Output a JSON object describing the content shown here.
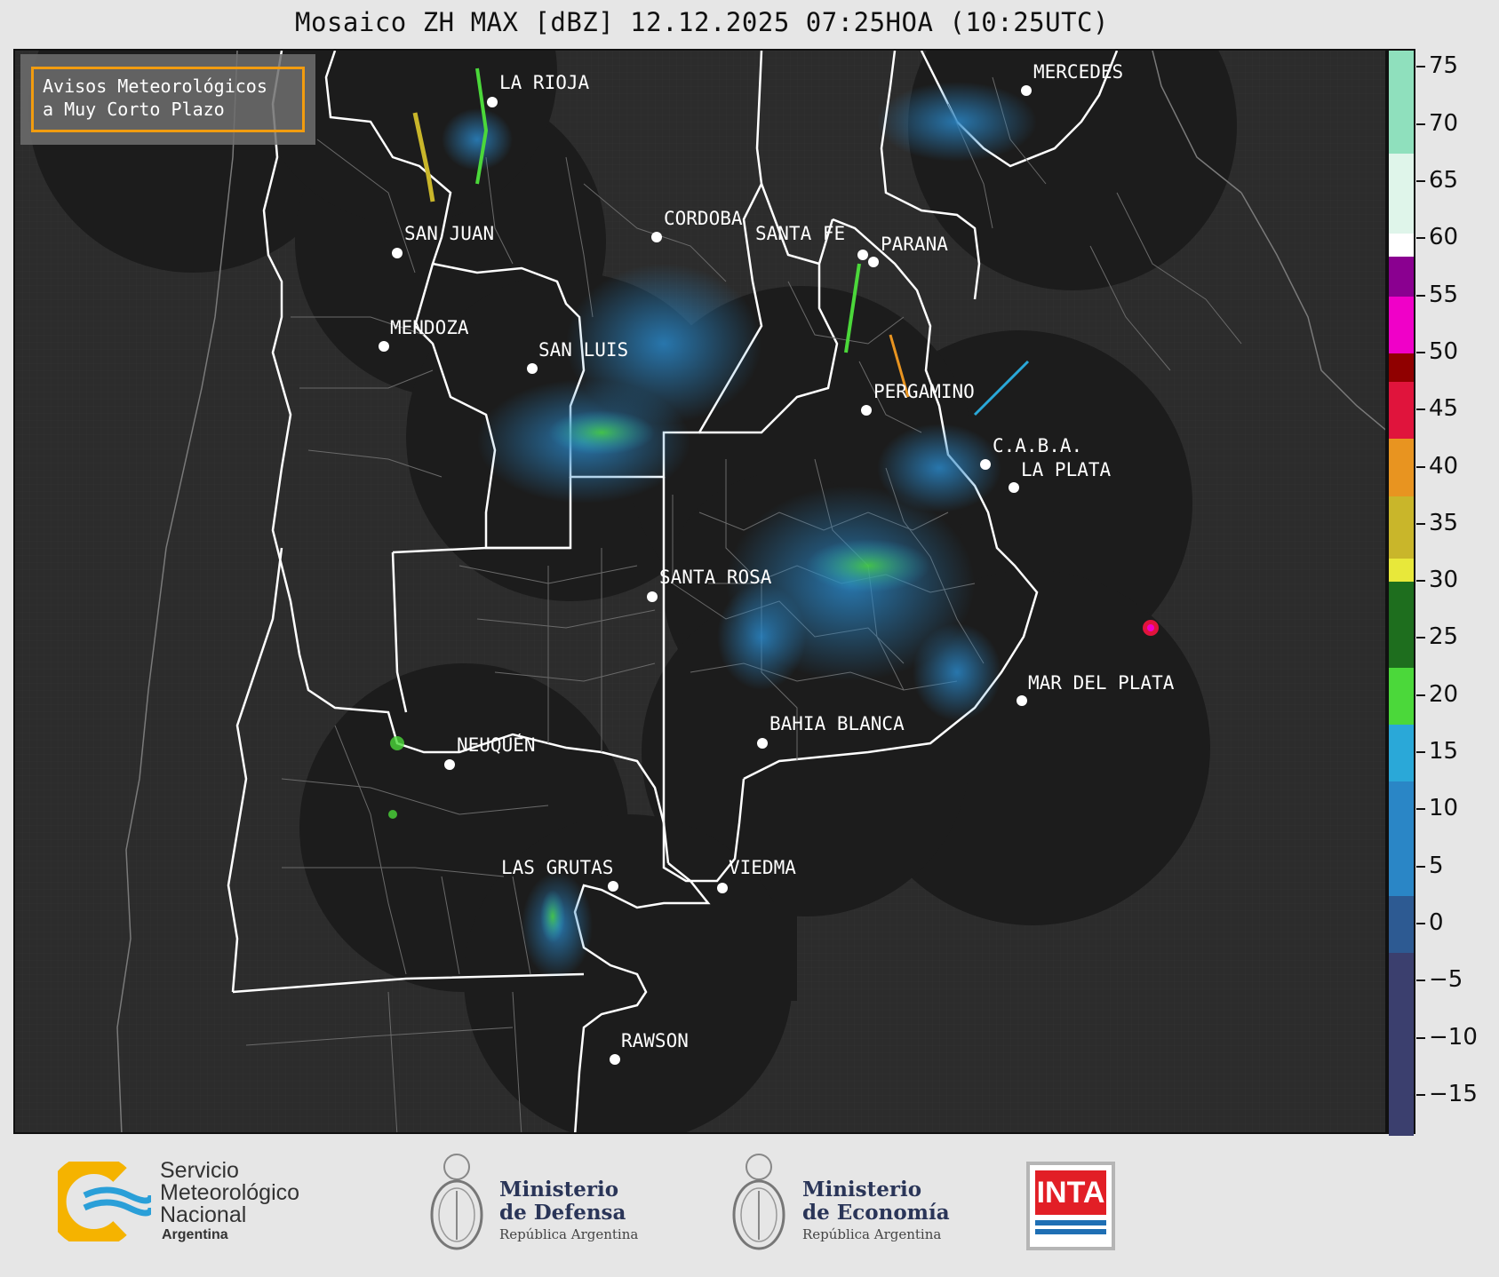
{
  "title": "Mosaico ZH MAX [dBZ] 12.12.2025 07:25HOA (10:25UTC)",
  "notice": {
    "line1": "Avisos Meteorológicos",
    "line2": "a Muy Corto Plazo"
  },
  "cities": [
    {
      "id": "la-rioja",
      "name": "LA RIOJA"
    },
    {
      "id": "mercedes",
      "name": "MERCEDES"
    },
    {
      "id": "cordoba",
      "name": "CORDOBA"
    },
    {
      "id": "san-juan",
      "name": "SAN JUAN"
    },
    {
      "id": "santa-fe",
      "name": "SANTA FE"
    },
    {
      "id": "parana",
      "name": "PARANA"
    },
    {
      "id": "mendoza",
      "name": "MENDOZA"
    },
    {
      "id": "san-luis",
      "name": "SAN LUIS"
    },
    {
      "id": "pergamino",
      "name": "PERGAMINO"
    },
    {
      "id": "caba",
      "name": "C.A.B.A."
    },
    {
      "id": "la-plata",
      "name": "LA PLATA"
    },
    {
      "id": "santa-rosa",
      "name": "SANTA ROSA"
    },
    {
      "id": "mar-del-plata",
      "name": "MAR DEL PLATA"
    },
    {
      "id": "bahia-blanca",
      "name": "BAHIA BLANCA"
    },
    {
      "id": "neuquen",
      "name": "NEUQUÉN"
    },
    {
      "id": "las-grutas",
      "name": "LAS GRUTAS"
    },
    {
      "id": "viedma",
      "name": "VIEDMA"
    },
    {
      "id": "rawson",
      "name": "RAWSON"
    }
  ],
  "colorbar": {
    "ticks": [
      "75",
      "70",
      "65",
      "60",
      "55",
      "50",
      "45",
      "40",
      "35",
      "30",
      "25",
      "20",
      "15",
      "10",
      "5",
      "0",
      "−5",
      "−10",
      "−15"
    ],
    "colors": {
      "lowest": "#3b3f6e",
      "blue_dark": "#2d5a92",
      "blue": "#2a86c6",
      "cyan": "#2aa8d8",
      "green_light": "#4bd83a",
      "green_dark": "#1e6e1e",
      "yellow": "#e8e83a",
      "olive": "#c9b62a",
      "orange": "#e89420",
      "red": "#e0143c",
      "dark_red": "#900000",
      "magenta": "#f000c8",
      "purple": "#8a0090",
      "white": "#ffffff",
      "mint_light": "#dff5ea",
      "mint": "#8fe0bd"
    }
  },
  "footer": {
    "smn": {
      "line1": "Servicio",
      "line2": "Meteorológico",
      "line3": "Nacional",
      "line4": "Argentina"
    },
    "defensa": {
      "line1": "Ministerio",
      "line2": "de Defensa",
      "sub": "República Argentina"
    },
    "economia": {
      "line1": "Ministerio",
      "line2": "de Economía",
      "sub": "República Argentina"
    },
    "inta": {
      "label": "INTA"
    }
  }
}
